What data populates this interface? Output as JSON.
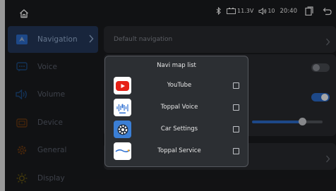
{
  "status": {
    "battery_voltage": "11.3V",
    "volume": "10",
    "time": "20:40"
  },
  "sidebar": {
    "items": [
      {
        "label": "Navigation",
        "icon": "navigation-icon",
        "active": true
      },
      {
        "label": "Voice",
        "icon": "voice-icon",
        "active": false
      },
      {
        "label": "Volume",
        "icon": "volume-icon",
        "active": false
      },
      {
        "label": "Device",
        "icon": "device-icon",
        "active": false
      },
      {
        "label": "General",
        "icon": "gear-icon",
        "active": false
      },
      {
        "label": "Display",
        "icon": "display-icon",
        "active": false
      }
    ]
  },
  "main": {
    "default_navigation_label": "Default navigation"
  },
  "modal": {
    "title": "Navi map list",
    "apps": [
      {
        "name": "YouTube",
        "icon": "youtube-icon",
        "checked": false
      },
      {
        "name": "Toppal Voice",
        "icon": "toppal-voice-icon",
        "checked": false
      },
      {
        "name": "Car Settings",
        "icon": "car-settings-icon",
        "checked": false
      },
      {
        "name": "Toppal Service",
        "icon": "toppal-service-icon",
        "checked": false
      }
    ]
  },
  "colors": {
    "accent": "#2d6fd1",
    "sidebar_active": "#253a5c",
    "youtube_red": "#e62117"
  }
}
